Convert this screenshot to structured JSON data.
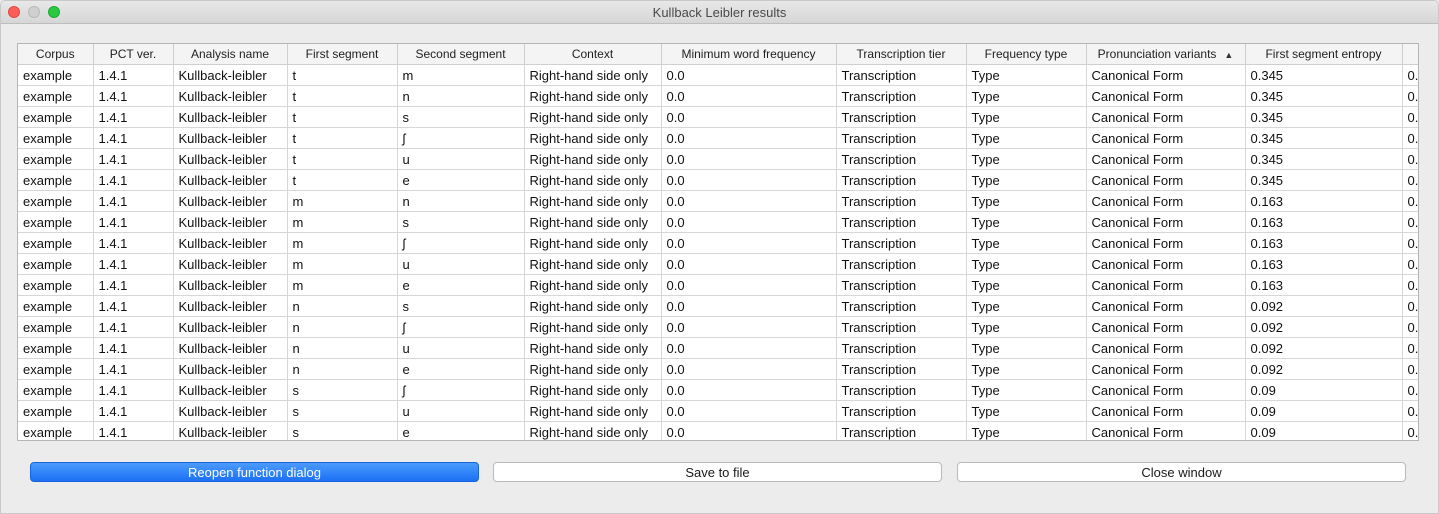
{
  "window": {
    "title": "Kullback Leibler results"
  },
  "table": {
    "columns": [
      {
        "label": "Corpus"
      },
      {
        "label": "PCT ver."
      },
      {
        "label": "Analysis name"
      },
      {
        "label": "First segment"
      },
      {
        "label": "Second segment"
      },
      {
        "label": "Context"
      },
      {
        "label": "Minimum word frequency"
      },
      {
        "label": "Transcription tier"
      },
      {
        "label": "Frequency type"
      },
      {
        "label": "Pronunciation variants",
        "sorted": "ascending"
      },
      {
        "label": "First segment entropy"
      },
      {
        "label": ""
      }
    ],
    "rows": [
      [
        "example",
        "1.4.1",
        "Kullback-leibler",
        "t",
        "m",
        "Right-hand side only",
        "0.0",
        "Transcription",
        "Type",
        "Canonical Form",
        "0.345",
        "0."
      ],
      [
        "example",
        "1.4.1",
        "Kullback-leibler",
        "t",
        "n",
        "Right-hand side only",
        "0.0",
        "Transcription",
        "Type",
        "Canonical Form",
        "0.345",
        "0."
      ],
      [
        "example",
        "1.4.1",
        "Kullback-leibler",
        "t",
        "s",
        "Right-hand side only",
        "0.0",
        "Transcription",
        "Type",
        "Canonical Form",
        "0.345",
        "0."
      ],
      [
        "example",
        "1.4.1",
        "Kullback-leibler",
        "t",
        "ʃ",
        "Right-hand side only",
        "0.0",
        "Transcription",
        "Type",
        "Canonical Form",
        "0.345",
        "0."
      ],
      [
        "example",
        "1.4.1",
        "Kullback-leibler",
        "t",
        "u",
        "Right-hand side only",
        "0.0",
        "Transcription",
        "Type",
        "Canonical Form",
        "0.345",
        "0."
      ],
      [
        "example",
        "1.4.1",
        "Kullback-leibler",
        "t",
        "e",
        "Right-hand side only",
        "0.0",
        "Transcription",
        "Type",
        "Canonical Form",
        "0.345",
        "0."
      ],
      [
        "example",
        "1.4.1",
        "Kullback-leibler",
        "m",
        "n",
        "Right-hand side only",
        "0.0",
        "Transcription",
        "Type",
        "Canonical Form",
        "0.163",
        "0."
      ],
      [
        "example",
        "1.4.1",
        "Kullback-leibler",
        "m",
        "s",
        "Right-hand side only",
        "0.0",
        "Transcription",
        "Type",
        "Canonical Form",
        "0.163",
        "0."
      ],
      [
        "example",
        "1.4.1",
        "Kullback-leibler",
        "m",
        "ʃ",
        "Right-hand side only",
        "0.0",
        "Transcription",
        "Type",
        "Canonical Form",
        "0.163",
        "0."
      ],
      [
        "example",
        "1.4.1",
        "Kullback-leibler",
        "m",
        "u",
        "Right-hand side only",
        "0.0",
        "Transcription",
        "Type",
        "Canonical Form",
        "0.163",
        "0."
      ],
      [
        "example",
        "1.4.1",
        "Kullback-leibler",
        "m",
        "e",
        "Right-hand side only",
        "0.0",
        "Transcription",
        "Type",
        "Canonical Form",
        "0.163",
        "0."
      ],
      [
        "example",
        "1.4.1",
        "Kullback-leibler",
        "n",
        "s",
        "Right-hand side only",
        "0.0",
        "Transcription",
        "Type",
        "Canonical Form",
        "0.092",
        "0."
      ],
      [
        "example",
        "1.4.1",
        "Kullback-leibler",
        "n",
        "ʃ",
        "Right-hand side only",
        "0.0",
        "Transcription",
        "Type",
        "Canonical Form",
        "0.092",
        "0."
      ],
      [
        "example",
        "1.4.1",
        "Kullback-leibler",
        "n",
        "u",
        "Right-hand side only",
        "0.0",
        "Transcription",
        "Type",
        "Canonical Form",
        "0.092",
        "0."
      ],
      [
        "example",
        "1.4.1",
        "Kullback-leibler",
        "n",
        "e",
        "Right-hand side only",
        "0.0",
        "Transcription",
        "Type",
        "Canonical Form",
        "0.092",
        "0."
      ],
      [
        "example",
        "1.4.1",
        "Kullback-leibler",
        "s",
        "ʃ",
        "Right-hand side only",
        "0.0",
        "Transcription",
        "Type",
        "Canonical Form",
        "0.09",
        "0."
      ],
      [
        "example",
        "1.4.1",
        "Kullback-leibler",
        "s",
        "u",
        "Right-hand side only",
        "0.0",
        "Transcription",
        "Type",
        "Canonical Form",
        "0.09",
        "0."
      ],
      [
        "example",
        "1.4.1",
        "Kullback-leibler",
        "s",
        "e",
        "Right-hand side only",
        "0.0",
        "Transcription",
        "Type",
        "Canonical Form",
        "0.09",
        "0."
      ]
    ]
  },
  "buttons": {
    "reopen": "Reopen function dialog",
    "save": "Save to file",
    "close": "Close window"
  },
  "colors": {
    "primary_button": "#1c70f5",
    "close_light": "#fc5f57",
    "zoom_light": "#2ac940"
  }
}
